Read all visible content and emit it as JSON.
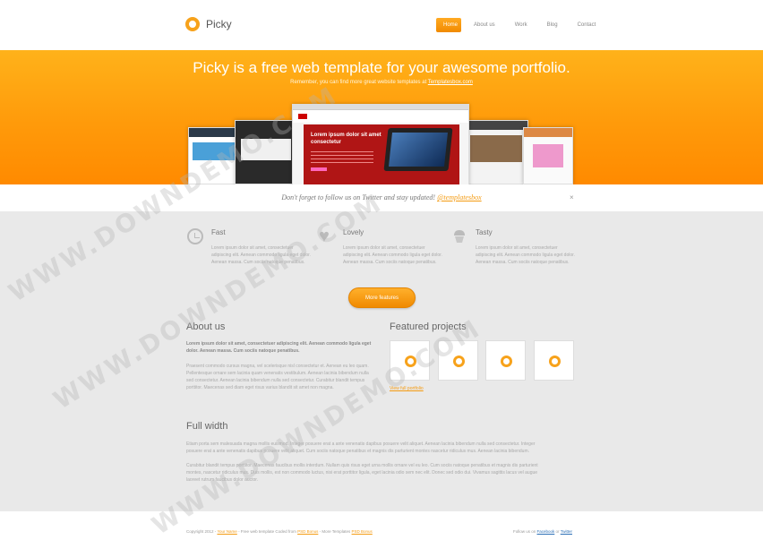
{
  "brand": {
    "name": "Picky",
    "accent": "#f7a21b"
  },
  "nav": {
    "items": [
      {
        "label": "Home",
        "active": true
      },
      {
        "label": "About us",
        "active": false
      },
      {
        "label": "Work",
        "active": false
      },
      {
        "label": "Blog",
        "active": false
      },
      {
        "label": "Contact",
        "active": false
      }
    ]
  },
  "hero": {
    "title": "Picky is a free web template for your awesome portfolio.",
    "sub_prefix": "Remember, you can find more great website templates at ",
    "sub_link": "Templatesbox.com",
    "slide_title": "Lorem ipsum dolor sit amet consectetur"
  },
  "tweet": {
    "prefix": "Don't forget to follow us on Twitter and stay updated! ",
    "handle": "@templatesbox",
    "close": "×"
  },
  "features": [
    {
      "title": "Fast",
      "icon": "clock-icon",
      "text": "Lorem ipsum dolor sit amet, consectetuer adipiscing elit. Aenean commodo ligula eget dolor. Aenean massa. Cum sociis natoque penatibus."
    },
    {
      "title": "Lovely",
      "icon": "heart-icon",
      "text": "Lorem ipsum dolor sit amet, consectetuer adipiscing elit. Aenean commodo ligula eget dolor. Aenean massa. Cum sociis natoque penatibus."
    },
    {
      "title": "Tasty",
      "icon": "cupcake-icon",
      "text": "Lorem ipsum dolor sit amet, consectetuer adipiscing elit. Aenean commodo ligula eget dolor. Aenean massa. Cum sociis natoque penatibus."
    }
  ],
  "more_features_label": "More features",
  "about": {
    "title": "About us",
    "lead": "Lorem ipsum dolor sit amet, consectetuer adipiscing elit. Aenean commodo ligula eget dolor. Aenean massa. Cum sociis natoque penatibus.",
    "body": "Praesent commodo cursus magna, vel scelerisque nisl consectetur et. Aenean eu leo quam. Pellentesque ornare sem lacinia quam venenatis vestibulum. Aenean lacinia bibendum nulla sed consectetur. Aenean lacinia bibendum nulla sed consectetur. Curabitur blandit tempus porttitor. Maecenas sed diam eget risus varius blandit sit amet non magna."
  },
  "featured": {
    "title": "Featured projects",
    "link": "View full portfolio"
  },
  "fullwidth": {
    "title": "Full width",
    "p1": "Etiam porta sem malesuada magna mollis euismod. Integer posuere erat a ante venenatis dapibus posuere velit aliquet. Aenean lacinia bibendum nulla sed consectetur. Integer posuere erat a ante venenatis dapibus posuere velit aliquet. Cum sociis natoque penatibus et magnis dis parturient montes, nascetur ridiculus mus. Duis mollis, est non commodo luctus, nisi erat porttitor ligula, eget lacinia odio sem nec elit. Donec sed odio dui. Vivamus sagittis lacus vel augue laoreet rutrum faucibus dolor auctor.",
    "p1a": "Etiam porta sem malesuada magna mollis euismod. Integer posuere erat a ante venenatis dapibus posuere velit aliquet. Aenean lacinia bibendum nulla sed consectetur. Integer",
    "p1b": "posuere erat a ante venenatis dapibus posuere velit aliquet. Cum sociis natoque penatibus et magnis dis parturient montes nascetur ridiculus mus. Aenean lacinia bibendum.",
    "p2a": "Curabitur blandit tempus porttitor. Maecenas faucibus mollis interdum. Nullam quis risus eget urna mollis ornare vel eu leo. Cum sociis natoque penatibus et magnis dis parturient",
    "p2b": "montes, nascetur ridiculus mus. Duis mollis, est non commodo luctus, nisi erat porttitor ligula, eget lacinia odio sem nec elit. Donec sed odio dui. Vivamus sagittis lacus vel augue",
    "p2c": "laoreet rutrum faucibus dolor auctor."
  },
  "footer": {
    "left_prefix": "Copyright 2012 - ",
    "left_name": "Your Name",
    "left_mid": " - Free web template Coded from ",
    "left_link1": "PSD Bonus",
    "left_mid2": " - More Templates ",
    "left_link2": "PSD Bonus",
    "right_prefix": "Follow us on ",
    "right_fb": "Facebook",
    "right_or": " or ",
    "right_tw": "Twitter"
  },
  "watermark": "WWW.DOWNDEMO.COM"
}
